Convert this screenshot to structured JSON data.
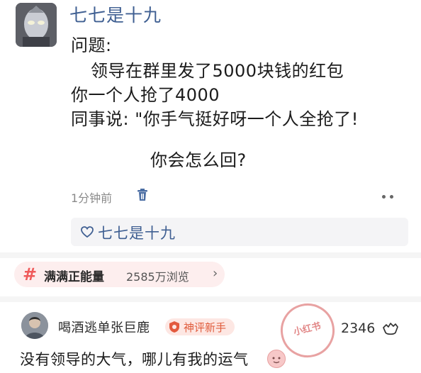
{
  "post": {
    "author": "七七是十九",
    "avatar_icon": "ultraman-avatar-icon",
    "lines": [
      "问题:",
      "领导在群里发了5000块钱的红包",
      "你一个人抢了4000",
      "同事说: \"你手气挺好呀一个人全抢了!",
      "你会怎么回?"
    ],
    "time": "1分钟前",
    "liked_by": "七七是十九"
  },
  "topic": {
    "name": "满满正能量",
    "views": "2585万浏览",
    "chevron": "›"
  },
  "comment": {
    "author": "喝酒逃单张巨鹿",
    "badge": "神评新手",
    "stamp_text": "小红书",
    "likes": "2346",
    "text": "没有领导的大气，哪儿有我的运气"
  },
  "colors": {
    "name_blue": "#3f5f92",
    "topic_red": "#ef5a5a",
    "badge_orange": "#e05c3c"
  }
}
